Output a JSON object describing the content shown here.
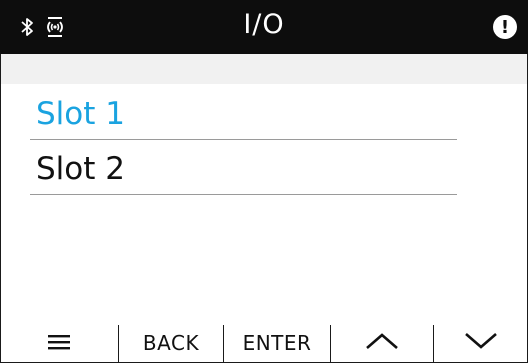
{
  "header": {
    "title": "I/O",
    "left_icons": [
      "bluetooth-icon",
      "remote-signal-icon"
    ],
    "alert_glyph": "!"
  },
  "list": {
    "items": [
      {
        "label": "Slot 1",
        "selected": true
      },
      {
        "label": "Slot 2",
        "selected": false
      }
    ]
  },
  "softkeys": {
    "menu_icon": "menu-icon",
    "back": "BACK",
    "enter": "ENTER",
    "up_icon": "chevron-up-icon",
    "down_icon": "chevron-down-icon"
  },
  "colors": {
    "header_bg": "#0d0d0d",
    "selected_text": "#1aa3e0"
  }
}
